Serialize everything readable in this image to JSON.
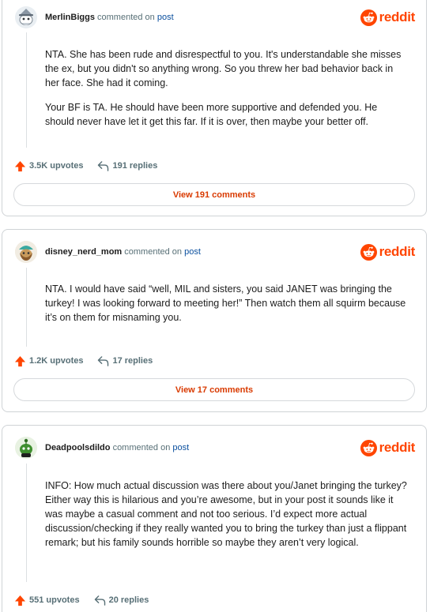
{
  "brand": {
    "wordmark": "reddit",
    "color": "#ff4500"
  },
  "comments": [
    {
      "username": "MerlinBiggs",
      "commented_on": "commented on",
      "post_link": "post",
      "paragraphs": [
        "NTA. She has been rude and disrespectful to you. It's understandable she misses the ex, but you didn't so anything wrong. So you threw her bad behavior back in her face. She had it coming.",
        "Your BF is TA. He should have been more supportive and defended you. He should never have let it get this far. If it is over, then maybe your better off."
      ],
      "upvotes": "3.5K upvotes",
      "replies": "191 replies",
      "view_comments": "View 191 comments",
      "avatar_icon": "wizard-snoo-avatar"
    },
    {
      "username": "disney_nerd_mom",
      "commented_on": "commented on",
      "post_link": "post",
      "paragraphs": [
        "NTA. I would have said “well, MIL and sisters, you said JANET was bringing the turkey! I was looking forward to meeting her!” Then watch them all squirm because it’s on them for misnaming you."
      ],
      "upvotes": "1.2K upvotes",
      "replies": "17 replies",
      "view_comments": "View 17 comments",
      "avatar_icon": "pirate-snoo-avatar"
    },
    {
      "username": "Deadpoolsdildo",
      "commented_on": "commented on",
      "post_link": "post",
      "paragraphs": [
        "INFO: How much actual discussion was there about you/Janet bringing the turkey? Either way this is hilarious and you’re awesome, but in your post it sounds like it was maybe a casual comment and not too serious. I’d expect more actual discussion/checking if they really wanted you to bring the turkey than just a flippant remark; but his family sounds horrible so maybe they aren’t very logical."
      ],
      "upvotes": "551 upvotes",
      "replies": "20 replies",
      "avatar_icon": "green-snoo-avatar"
    }
  ]
}
